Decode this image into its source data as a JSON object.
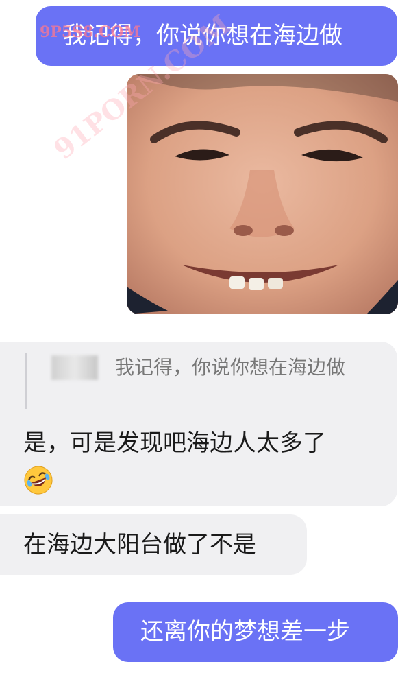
{
  "messages": [
    {
      "direction": "sent",
      "text": "我记得，你说你想在海边做"
    },
    {
      "direction": "sent",
      "type": "image",
      "description_icon": "grinning-face-photo"
    },
    {
      "direction": "received",
      "quote": {
        "text": "我记得，你说你想在海边做"
      },
      "text": "是，可是发现吧海边人太多了",
      "emoji": "rolling-on-floor-laughing-icon"
    },
    {
      "direction": "received",
      "text": "在海边大阳台做了不是"
    },
    {
      "direction": "sent",
      "text": "还离你的梦想差一步"
    }
  ],
  "watermarks": [
    "9P5S8.COM",
    "91PORN.COM"
  ],
  "colors": {
    "sent_bubble": "#6a72f5",
    "received_bubble": "#f0f0f2",
    "background": "#ffffff"
  }
}
